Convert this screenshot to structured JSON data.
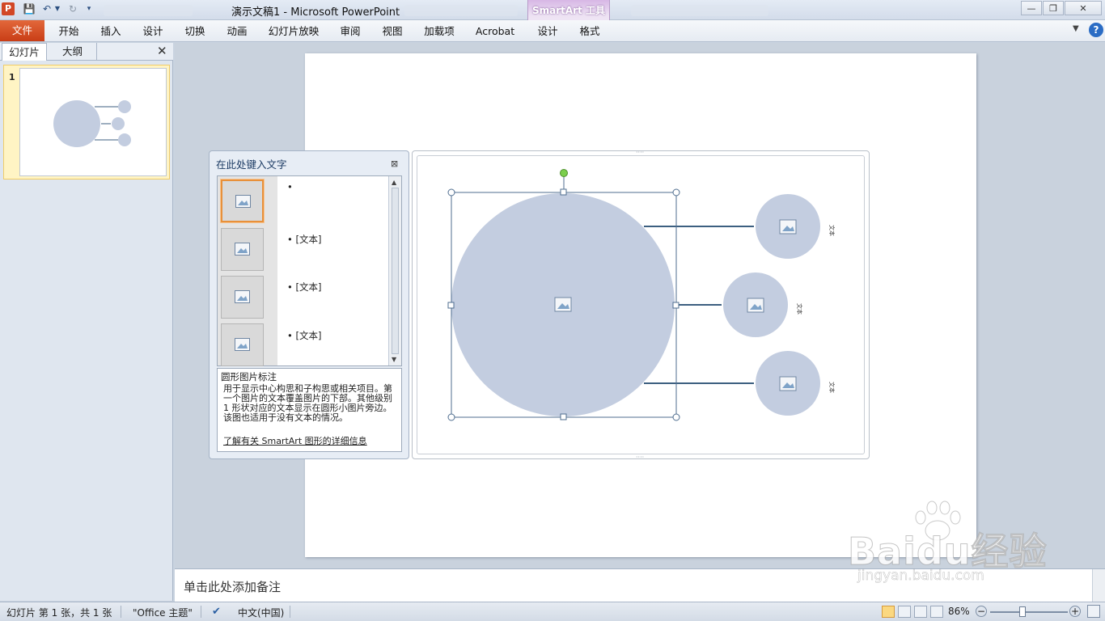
{
  "titlebar": {
    "app_icon": "P",
    "window_title": "演示文稿1  -  Microsoft PowerPoint",
    "contextual_group": "SmartArt 工具",
    "qat": {
      "save": "save-icon",
      "undo": "undo-icon",
      "redo": "redo-icon",
      "customize": "customize-icon"
    }
  },
  "ribbon": {
    "file": "文件",
    "tabs": [
      "开始",
      "插入",
      "设计",
      "切换",
      "动画",
      "幻灯片放映",
      "审阅",
      "视图",
      "加载项",
      "Acrobat"
    ],
    "contextual_tabs": [
      "设计",
      "格式"
    ]
  },
  "left_pane": {
    "tab_slides": "幻灯片",
    "tab_outline": "大纲",
    "slide_number": "1"
  },
  "text_pane": {
    "title": "在此处键入文字",
    "bullets": [
      "",
      "[文本]",
      "[文本]",
      "[文本]"
    ],
    "description_title": "圆形图片标注",
    "description_body": "用于显示中心构思和子构思或相关项目。第一个图片的文本覆盖图片的下部。其他级别 1 形状对应的文本显示在圆形小图片旁边。该图也适用于没有文本的情况。",
    "learn_more_link": "了解有关 SmartArt 图形的详细信息"
  },
  "smartart": {
    "shape_color": "#c3cde0",
    "line_color": "#3c5f80",
    "small_circle_labels": [
      "文本",
      "文本",
      "文本"
    ]
  },
  "notes": {
    "placeholder": "单击此处添加备注"
  },
  "statusbar": {
    "slide_info": "幻灯片 第 1 张，共 1 张",
    "theme": "\"Office 主题\"",
    "language": "中文(中国)",
    "zoom": "86%"
  },
  "watermark": {
    "logo": "Baidu经验",
    "url": "jingyan.baidu.com"
  }
}
